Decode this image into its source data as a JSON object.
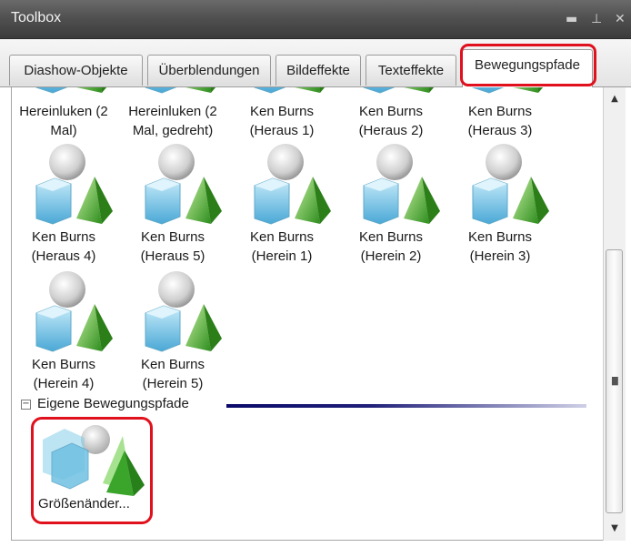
{
  "window": {
    "title": "Toolbox",
    "icons": [
      "minimize-icon",
      "pin-icon",
      "close-icon"
    ]
  },
  "tabs": [
    {
      "label": "Diashow-Objekte",
      "active": false
    },
    {
      "label": "Überblendungen",
      "active": false
    },
    {
      "label": "Bildeffekte",
      "active": false
    },
    {
      "label": "Texteffekte",
      "active": false
    },
    {
      "label": "Bewegungspfade",
      "active": true
    }
  ],
  "items": [
    {
      "label": "Hereinluken (2 Mal)"
    },
    {
      "label": "Hereinluken (2 Mal, gedreht)"
    },
    {
      "label": "Ken Burns (Heraus 1)"
    },
    {
      "label": "Ken Burns (Heraus 2)"
    },
    {
      "label": "Ken Burns (Heraus 3)"
    },
    {
      "label": "Ken Burns (Heraus 4)"
    },
    {
      "label": "Ken Burns (Heraus 5)"
    },
    {
      "label": "Ken Burns (Herein 1)"
    },
    {
      "label": "Ken Burns (Herein 2)"
    },
    {
      "label": "Ken Burns (Herein 3)"
    },
    {
      "label": "Ken Burns (Herein 4)"
    },
    {
      "label": "Ken Burns (Herein 5)"
    }
  ],
  "group": {
    "toggle": "⊟",
    "label": "Eigene Bewegungspfade"
  },
  "custom_items": [
    {
      "label": "Größenänder..."
    }
  ],
  "colors": {
    "highlight": "#e0101d",
    "titlebar": "#4a4a4a",
    "cube": "#7ec8e8",
    "pyramid": "#52b236",
    "sphere": "#d8d8d8"
  }
}
